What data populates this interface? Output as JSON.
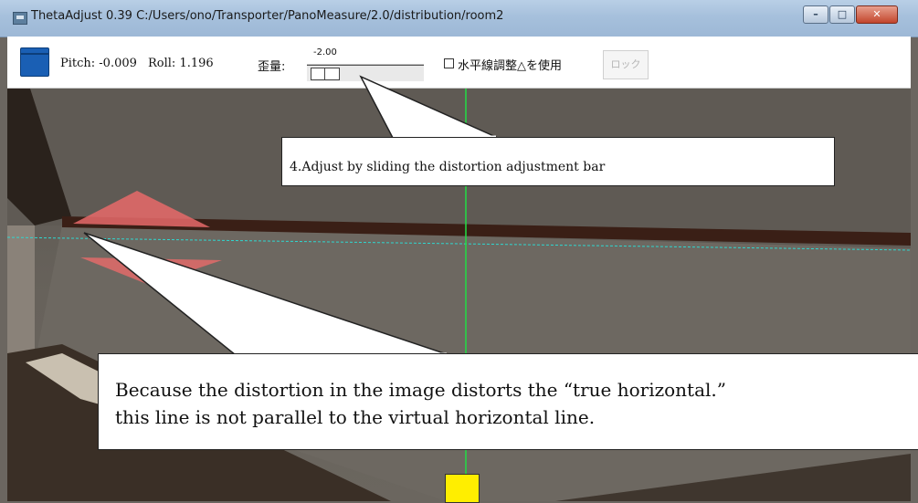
{
  "window": {
    "title": "ThetaAdjust 0.39  C:/Users/ono/Transporter/PanoMeasure/2.0/distribution/room2",
    "icon": "app-window-icon",
    "controls": {
      "minimize_icon": "minimize-icon",
      "maximize_icon": "maximize-icon",
      "close_icon": "close-icon"
    }
  },
  "toolbar": {
    "open_icon": "folder-icon",
    "pitch": "Pitch: -0.009",
    "roll": "Roll: 1.196",
    "distortion_label": "歪量:",
    "distortion_value": "-2.00",
    "checkbox_label": "水平線調整△を使用",
    "checkbox_checked": false,
    "lock_label": "ロック"
  },
  "annotations": {
    "top": "4.Adjust by sliding the distortion adjustment bar",
    "bottom_line1": "Because the distortion in the image distorts the “true horizontal.”",
    "bottom_line2": "this line is not parallel to the virtual horizontal line."
  },
  "colors": {
    "accent_blue": "#1a5fb4",
    "guide_vertical": "#22dd44",
    "guide_horizontal": "#2fd7d0",
    "marker_red": "#e86a6a",
    "marker_yellow": "#ffee00"
  }
}
